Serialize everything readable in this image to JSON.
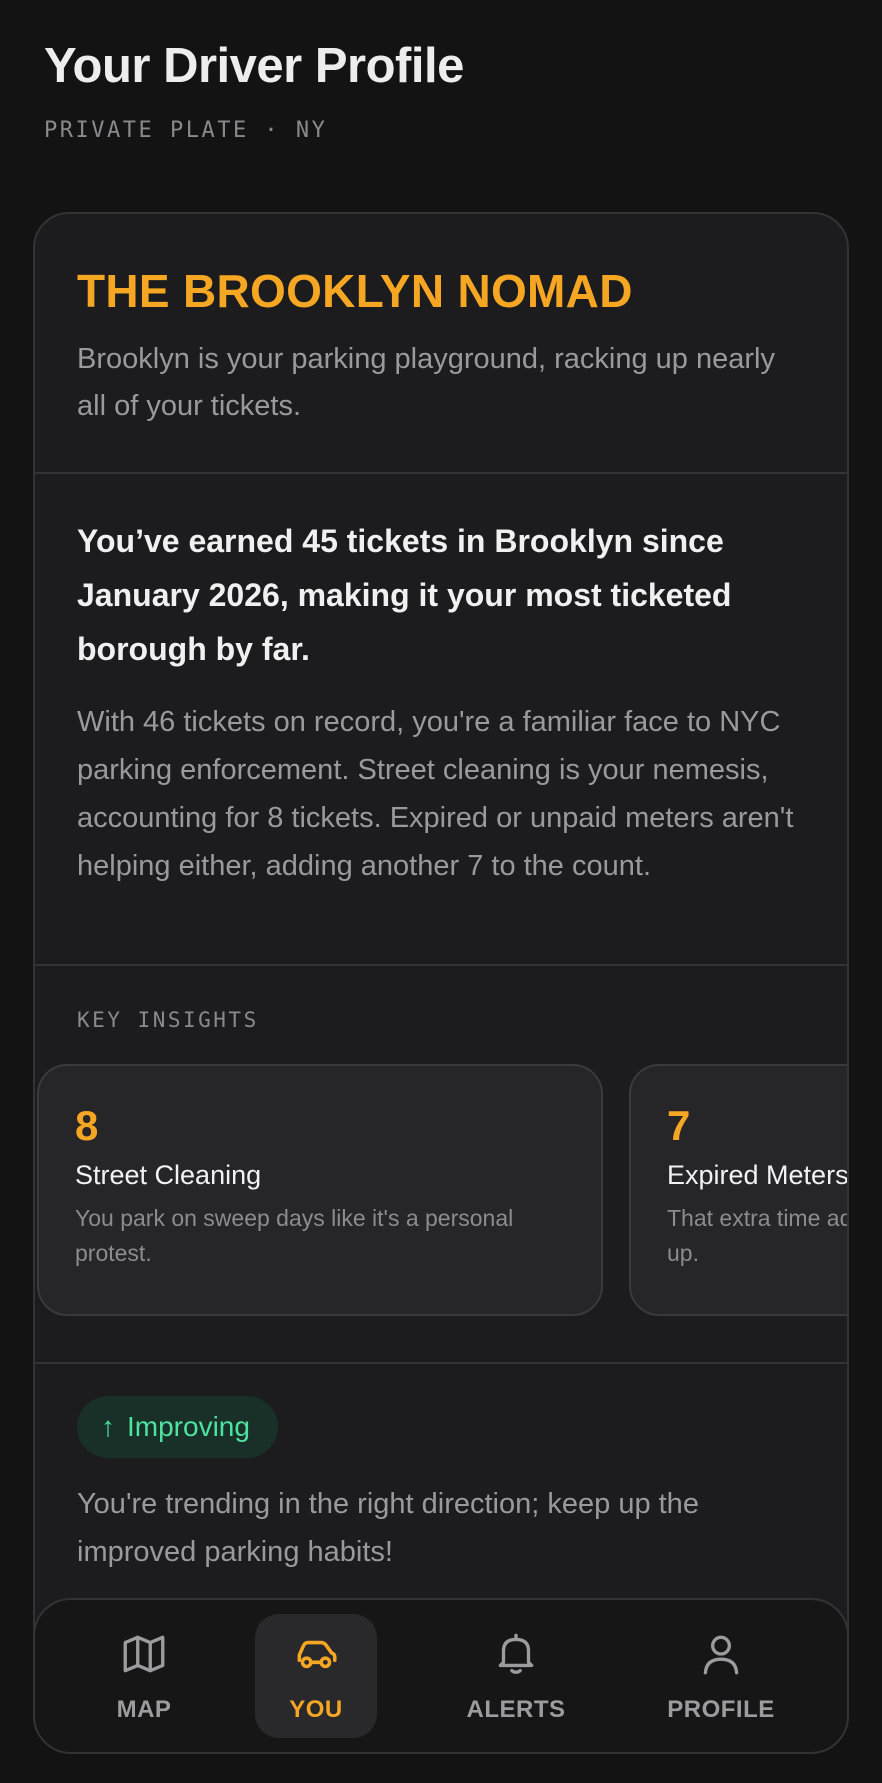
{
  "header": {
    "title": "Your Driver Profile",
    "subtitle": "PRIVATE PLATE · NY"
  },
  "persona": {
    "name": "THE BROOKLYN NOMAD",
    "description": "Brooklyn is your parking playground, racking up nearly all of your tickets."
  },
  "story": {
    "headline": "You’ve earned 45 tickets in Brooklyn since January 2026, making it your most ticketed borough by far.",
    "body": "With 46 tickets on record, you're a familiar face to NYC parking enforcement. Street cleaning is your nemesis, accounting for 8 tickets. Expired or unpaid meters aren't helping either, adding another 7 to the count."
  },
  "insights": {
    "title": "KEY INSIGHTS",
    "items": [
      {
        "value": "8",
        "label": "Street Cleaning",
        "description": "You park on sweep days like it's a personal protest."
      },
      {
        "value": "7",
        "label": "Expired Meters",
        "description": "That extra time adds up."
      }
    ]
  },
  "trend": {
    "badge": "Improving",
    "arrow_icon": "arrow-up-icon",
    "text": "You're trending in the right direction; keep up the improved parking habits!"
  },
  "tabbar": {
    "items": [
      {
        "label": "MAP",
        "icon": "map-icon",
        "active": false
      },
      {
        "label": "YOU",
        "icon": "car-icon",
        "active": true
      },
      {
        "label": "ALERTS",
        "icon": "bell-icon",
        "active": false
      },
      {
        "label": "PROFILE",
        "icon": "user-icon",
        "active": false
      }
    ]
  },
  "colors": {
    "background": "#131314",
    "card": "#1c1c1e",
    "accent": "#f5a623",
    "positive": "#4ee2a0",
    "positive_bg": "#183027",
    "muted_text": "#9a9a9d"
  }
}
